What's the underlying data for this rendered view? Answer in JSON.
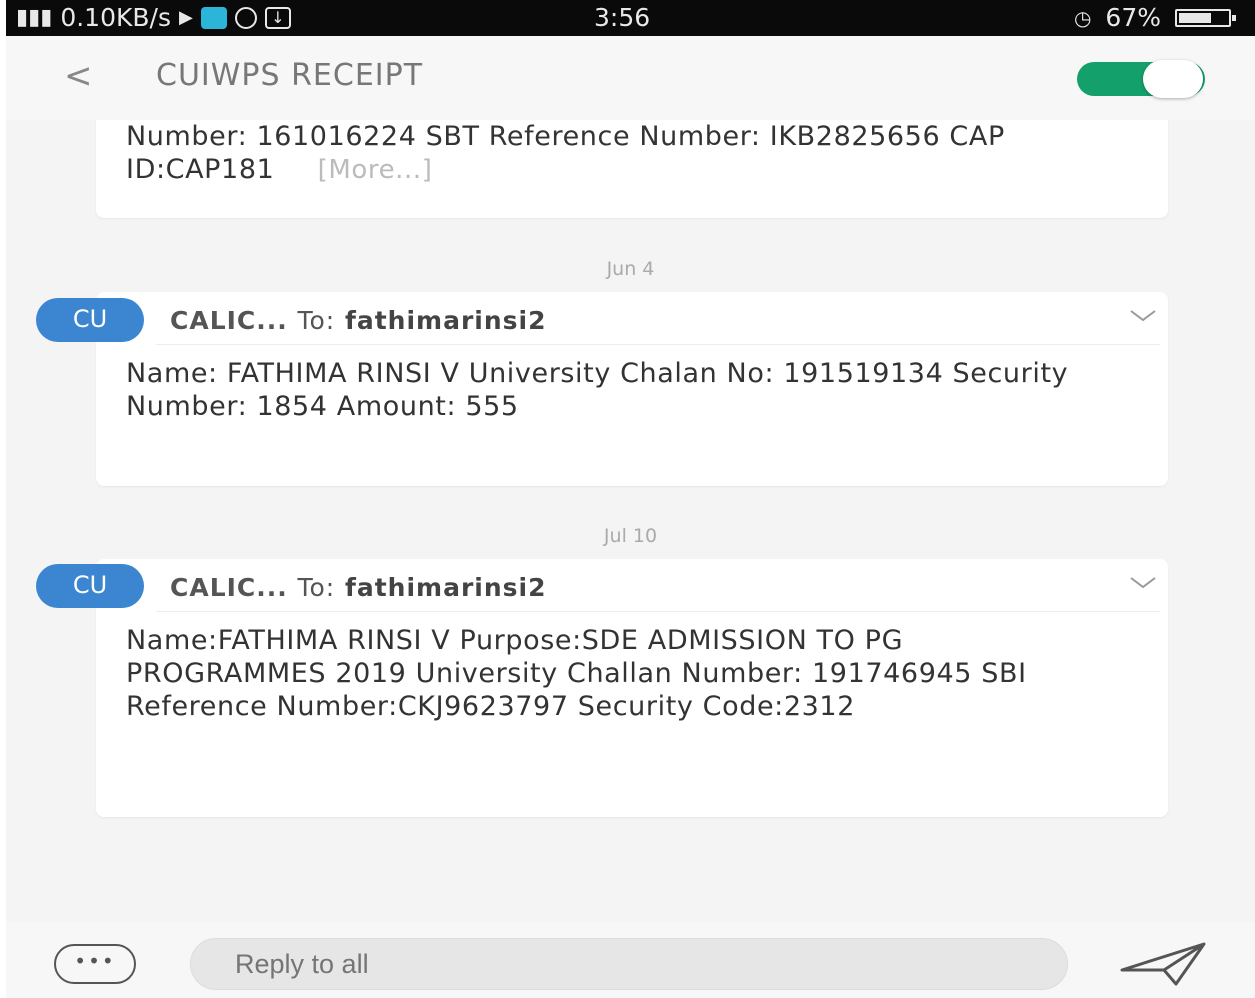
{
  "status_bar": {
    "network_speed": "0.10KB/s",
    "time": "3:56",
    "alarm_icon": "alarm-clock-icon",
    "battery_percent": "67%",
    "battery_level": 0.67
  },
  "header": {
    "back_icon": "chevron-left-icon",
    "title": "CUIWPS RECEIPT",
    "toggle_on": true,
    "toggle_color": "#14a06a"
  },
  "messages": [
    {
      "body": "Number: 161016224 SBT Reference Number: IKB2825656 CAP ID:CAP181",
      "more_label": "[More...]"
    },
    {
      "date": "Jun 4",
      "avatar": "CU",
      "sender": "CALIC...",
      "to_label": "To:",
      "recipient": "fathimarinsi2",
      "body": "Name: FATHIMA RINSI V University Chalan No: 191519134 Security Number: 1854 Amount: 555"
    },
    {
      "date": "Jul 10",
      "avatar": "CU",
      "sender": "CALIC...",
      "to_label": "To:",
      "recipient": "fathimarinsi2",
      "body": "Name:FATHIMA RINSI V Purpose:SDE ADMISSION TO PG PROGRAMMES 2019 University Challan Number: 191746945 SBI Reference Number:CKJ9623797 Security Code:2312"
    }
  ],
  "compose": {
    "emoji_icon": "ellipsis-bubble-icon",
    "placeholder": "Reply to all",
    "send_icon": "paper-plane-icon"
  },
  "colors": {
    "avatar": "#3c86d1",
    "accent": "#14a06a"
  }
}
